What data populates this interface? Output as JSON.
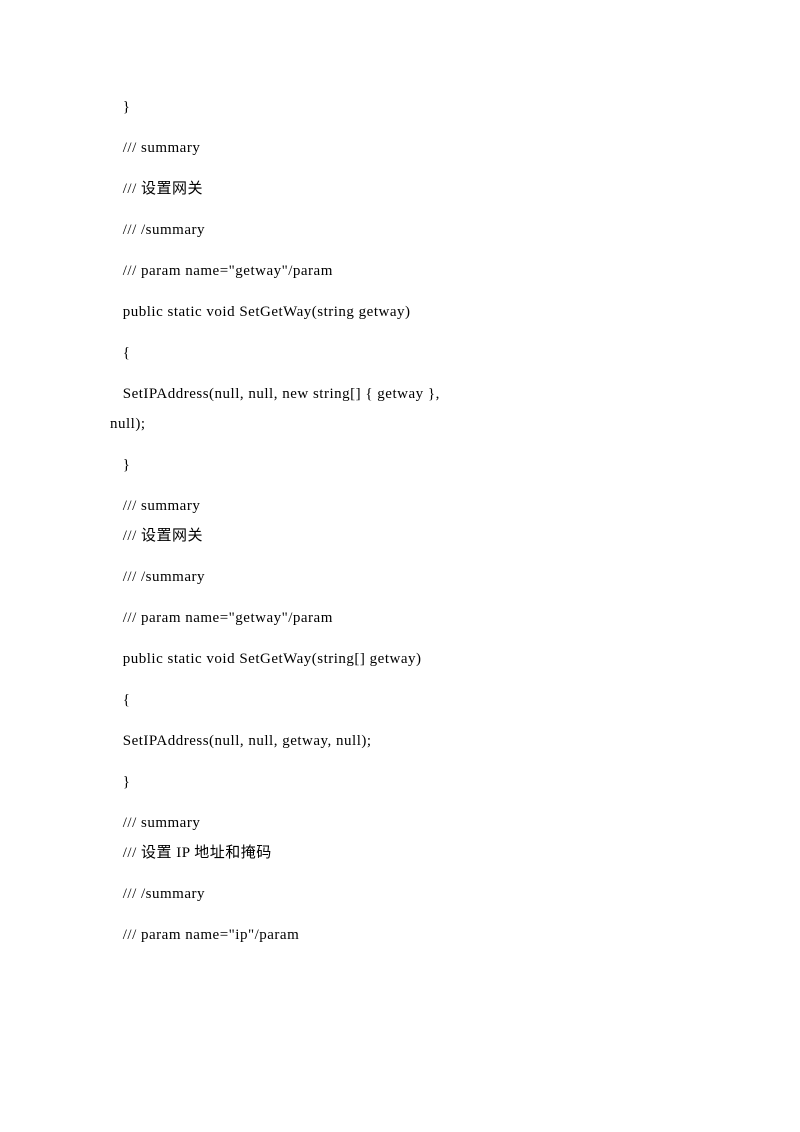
{
  "lines": [
    {
      "text": "   }",
      "tight": false
    },
    {
      "text": "   /// summary",
      "tight": false
    },
    {
      "text": "   /// 设置网关",
      "tight": false
    },
    {
      "text": "   /// /summary",
      "tight": false
    },
    {
      "text": "   /// param name=\"getway\"/param",
      "tight": false
    },
    {
      "text": "   public static void SetGetWay(string getway)",
      "tight": false
    },
    {
      "text": "   {",
      "tight": false
    },
    {
      "text": "   SetIPAddress(null, null, new string[] { getway },",
      "tight": true
    },
    {
      "text": "null);",
      "tight": false
    },
    {
      "text": "   }",
      "tight": false
    },
    {
      "text": "   /// summary",
      "tight": true
    },
    {
      "text": "   /// 设置网关",
      "tight": false
    },
    {
      "text": "   /// /summary",
      "tight": false
    },
    {
      "text": "   /// param name=\"getway\"/param",
      "tight": false
    },
    {
      "text": "   public static void SetGetWay(string[] getway)",
      "tight": false
    },
    {
      "text": "   {",
      "tight": false
    },
    {
      "text": "   SetIPAddress(null, null, getway, null);",
      "tight": false
    },
    {
      "text": "   }",
      "tight": false
    },
    {
      "text": "   /// summary",
      "tight": true
    },
    {
      "text": "   /// 设置 IP 地址和掩码",
      "tight": false
    },
    {
      "text": "   /// /summary",
      "tight": false
    },
    {
      "text": "   /// param name=\"ip\"/param",
      "tight": false
    }
  ]
}
